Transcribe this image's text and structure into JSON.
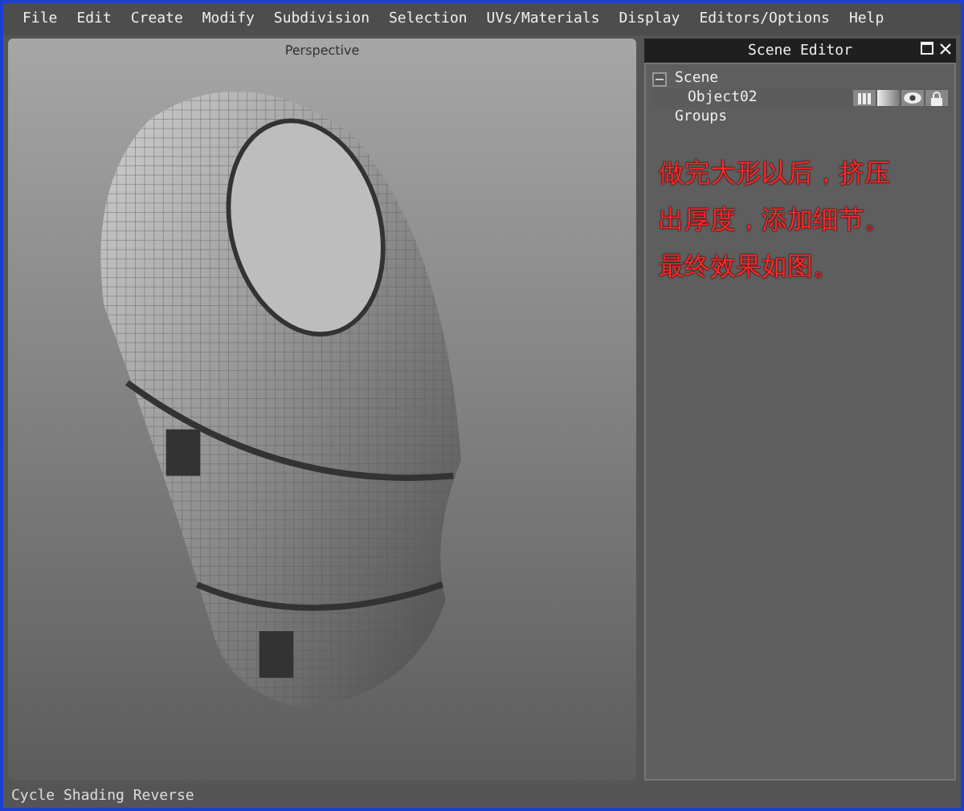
{
  "menu": [
    "File",
    "Edit",
    "Create",
    "Modify",
    "Subdivision",
    "Selection",
    "UVs/Materials",
    "Display",
    "Editors/Options",
    "Help"
  ],
  "viewport": {
    "title": "Perspective"
  },
  "scene_editor": {
    "title": "Scene Editor",
    "tree": [
      {
        "label": "Scene",
        "expanded": true,
        "children": [
          {
            "label": "Object02",
            "selected": true
          }
        ]
      },
      {
        "label": "Groups"
      }
    ],
    "annotation": [
      "做完大形以后，挤压",
      "出厚度，添加细节。",
      "最终效果如图。"
    ]
  },
  "status_bar": "Cycle Shading Reverse"
}
